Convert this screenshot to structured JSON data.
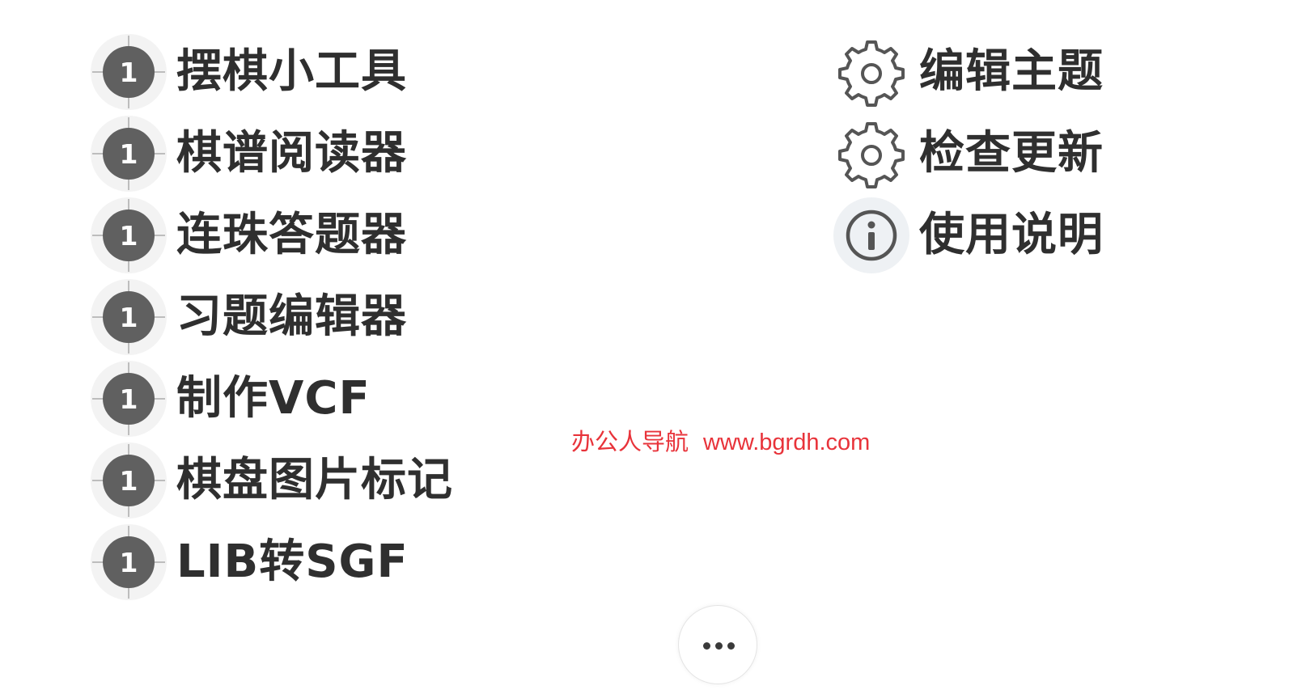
{
  "left_menu": [
    {
      "label": "摆棋小工具",
      "icon": "go-stone-1-icon",
      "stone_number": "1"
    },
    {
      "label": "棋谱阅读器",
      "icon": "go-stone-1-icon",
      "stone_number": "1"
    },
    {
      "label": "连珠答题器",
      "icon": "go-stone-1-icon",
      "stone_number": "1"
    },
    {
      "label": "习题编辑器",
      "icon": "go-stone-1-icon",
      "stone_number": "1"
    },
    {
      "label": "制作VCF",
      "icon": "go-stone-1-icon",
      "stone_number": "1"
    },
    {
      "label": "棋盘图片标记",
      "icon": "go-stone-1-icon",
      "stone_number": "1"
    },
    {
      "label": "LIB转SGF",
      "icon": "go-stone-1-icon",
      "stone_number": "1"
    }
  ],
  "right_menu": [
    {
      "label": "编辑主题",
      "icon": "gear-icon"
    },
    {
      "label": "检查更新",
      "icon": "gear-icon"
    },
    {
      "label": "使用说明",
      "icon": "info-icon"
    }
  ],
  "watermark": {
    "name": "办公人导航",
    "url": "www.bgrdh.com",
    "color": "#e8333a"
  },
  "more_button": {
    "icon": "more-dots-icon"
  },
  "colors": {
    "stone": "#606060",
    "text": "#2f2f2f",
    "icon_gray": "#555555"
  }
}
